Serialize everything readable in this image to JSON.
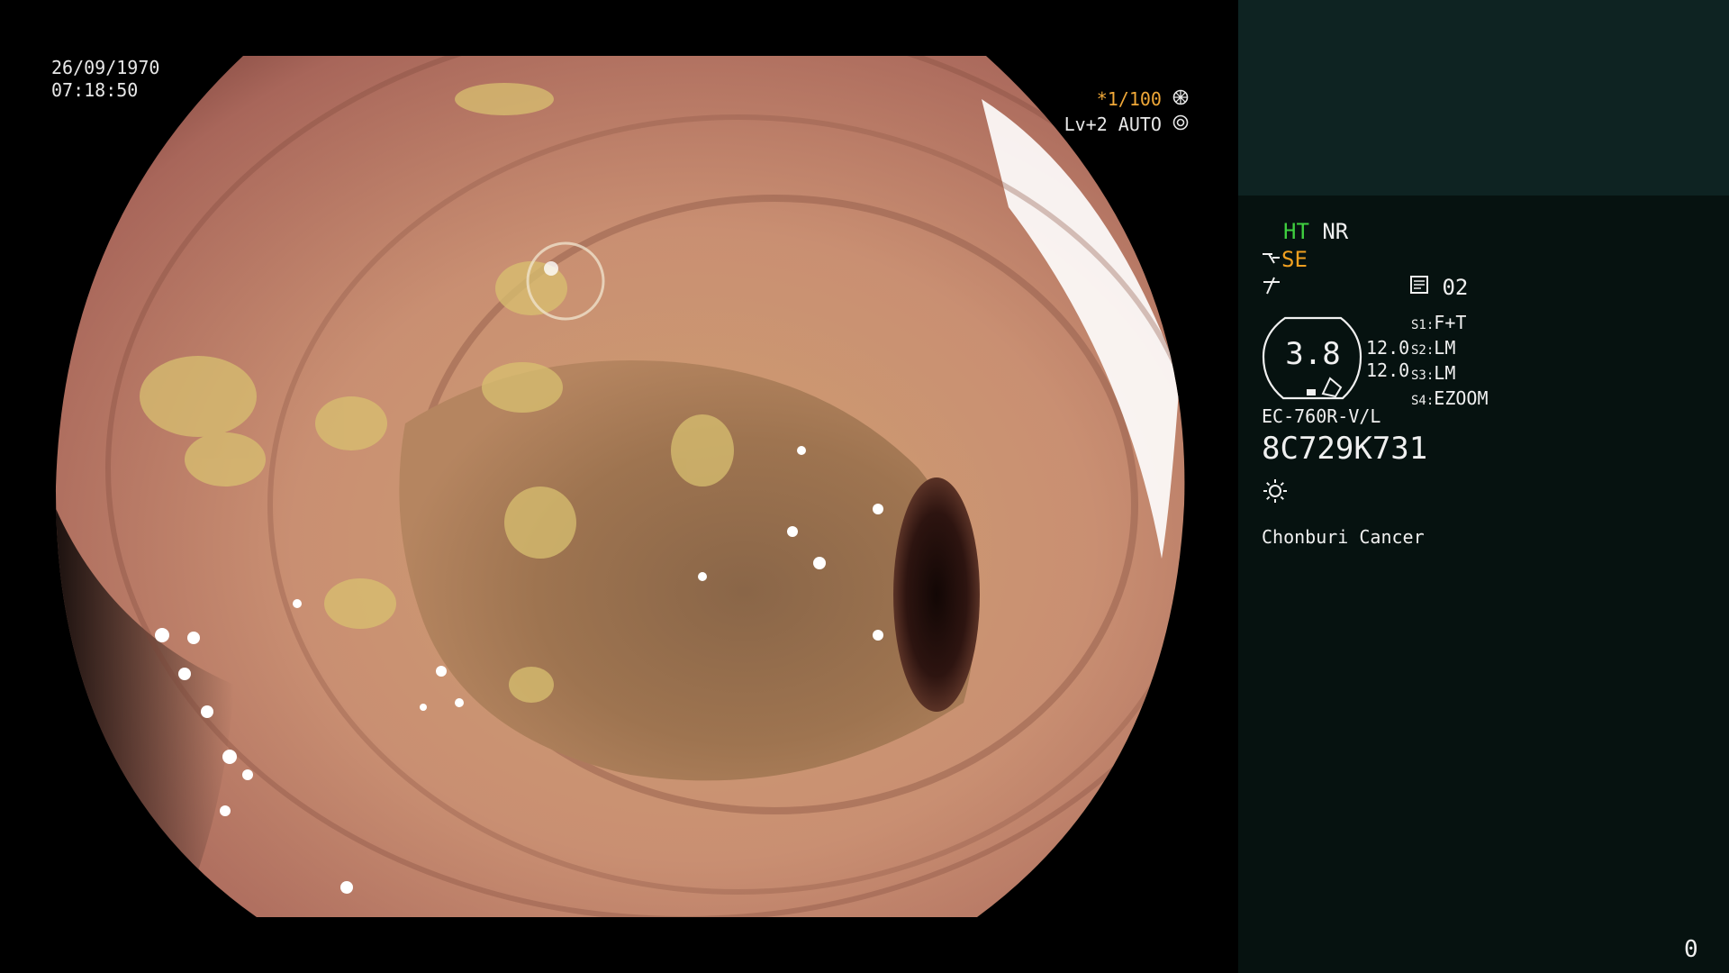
{
  "overlay": {
    "date": "26/09/1970",
    "time": "07:18:50",
    "shutter": "*1/100",
    "shutter_icon": "aperture-icon",
    "iris": "Lv+2 AUTO",
    "iris_icon": "iris-icon"
  },
  "sidebar": {
    "ht": "HT",
    "nr": "NR",
    "se": "SE",
    "se_icon": "scope-tip-icon",
    "enhance_icon": "enhancement-icon",
    "memo_icon": "memo-icon",
    "memo_number": "02",
    "zoom_value": "3.8",
    "zoom_icon": "zoom-indicator-icon",
    "scale_top": "12.0",
    "scale_bottom": "12.0",
    "switches": [
      {
        "key": "S1:",
        "value": "F+T"
      },
      {
        "key": "S2:",
        "value": "LM"
      },
      {
        "key": "S3:",
        "value": "LM"
      },
      {
        "key": "S4:",
        "value": "EZOOM"
      }
    ],
    "scope_model": "EC-760R-V/L",
    "serial": "8C729K731",
    "light_icon": "light-sun-icon",
    "institution": "Chonburi Cancer",
    "counter": "0"
  },
  "colors": {
    "ht_green": "#3fcf3f",
    "se_orange": "#f0a020",
    "shutter_orange": "#f0a838",
    "sidebar_bg": "#061210",
    "sidebar_top_bg": "#0e2322"
  }
}
